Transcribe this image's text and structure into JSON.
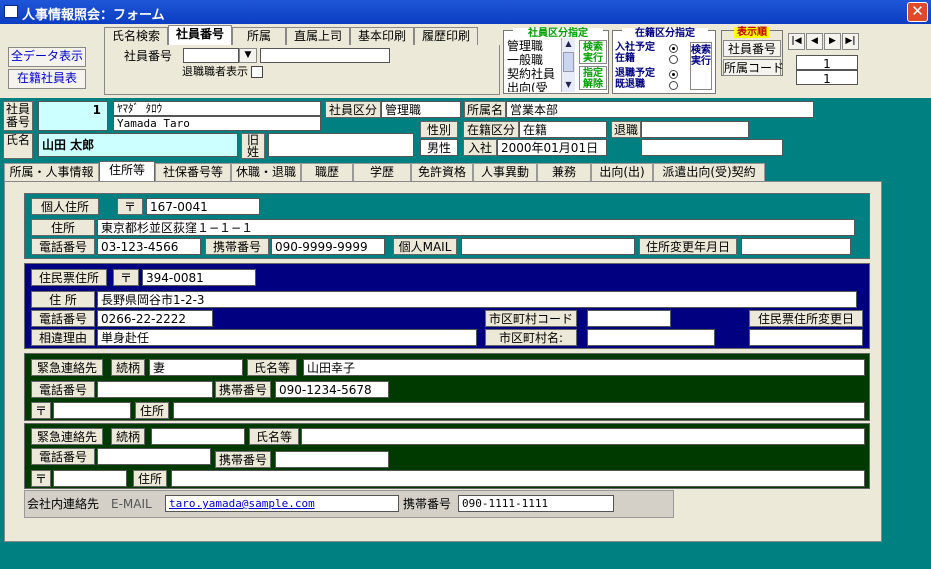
{
  "window": {
    "title": "人事情報照会：フォーム"
  },
  "header": {
    "search_tabs": [
      "氏名検索",
      "社員番号",
      "所属",
      "直属上司",
      "基本印刷",
      "履歴印刷"
    ],
    "all_data_button": "全データ表示",
    "active_employees_button": "在籍社員表",
    "employee_no_label": "社員番号",
    "retired_checkbox_label": "退職職者表示",
    "category_group": {
      "title": "社員区分指定",
      "items": [
        "管理職",
        "一般職",
        "契約社員",
        "出向(受"
      ],
      "search_button": "検索実行",
      "clear_button": "指定解除"
    },
    "status_group": {
      "title": "在籍区分指定",
      "options": [
        "入社予定",
        "在籍",
        "退職予定",
        "既退職"
      ],
      "selected": [
        0,
        2
      ],
      "search_button": "検索実行"
    },
    "display_order": {
      "title": "表示順",
      "employee_no_button": "社員番号",
      "dept_code_button": "所属コード"
    },
    "nav": {
      "first": "|◀",
      "prev": "◀",
      "next": "▶",
      "last": "▶|",
      "record": "1",
      "total": "1"
    }
  },
  "employee": {
    "emp_no_label": "社員番号",
    "emp_no": "1",
    "kana": "ﾔﾏﾀﾞ ﾀﾛｳ",
    "roman": "Yamada Taro",
    "category_label": "社員区分",
    "category": "管理職",
    "dept_label": "所属名",
    "dept": "営業本部",
    "name_label": "氏名",
    "name": "山田 太郎",
    "old_surname_label": "旧姓",
    "old_surname": "",
    "gender_label": "性別",
    "gender": "男性",
    "status_label": "在籍区分",
    "status": "在籍",
    "retire_label": "退職",
    "retire": "",
    "join_label": "入社",
    "join_date": "2000年01月01日"
  },
  "tabs": [
    "所属・人事情報",
    "住所等",
    "社保番号等",
    "休職・退職",
    "職歴",
    "学歴",
    "免許資格",
    "人事異動",
    "兼務",
    "出向(出)",
    "派遣出向(受)契約"
  ],
  "active_tab": 1,
  "personal": {
    "title": "個人住所",
    "postal_label": "〒",
    "postal": "167-0041",
    "address_label": "住所",
    "address": "東京都杉並区荻窪１−１−１",
    "phone_label": "電話番号",
    "phone": "03-123-4566",
    "mobile_label": "携帯番号",
    "mobile": "090-9999-9999",
    "mail_label": "個人MAIL",
    "mail": "",
    "changed_label": "住所変更年月日",
    "changed": ""
  },
  "resident": {
    "title": "住民票住所",
    "postal_label": "〒",
    "postal": "394-0081",
    "address_label": "住 所",
    "address": "長野県岡谷市1-2-3",
    "phone_label": "電話番号",
    "phone": "0266-22-2222",
    "city_code_label": "市区町村コード",
    "city_code": "",
    "reason_label": "相違理由",
    "reason": "単身赴任",
    "city_name_label": "市区町村名:",
    "city_name": "",
    "changed_label": "住民票住所変更日",
    "changed": ""
  },
  "emergency1": {
    "title": "緊急連絡先",
    "relation_label": "続柄",
    "relation": "妻",
    "name_label": "氏名等",
    "name": "山田幸子",
    "phone_label": "電話番号",
    "phone": "",
    "mobile_label": "携帯番号",
    "mobile": "090-1234-5678",
    "postal_label": "〒",
    "postal": "",
    "address_label": "住所",
    "address": ""
  },
  "emergency2": {
    "title": "緊急連絡先",
    "relation_label": "続柄",
    "relation": "",
    "name_label": "氏名等",
    "name": "",
    "phone_label": "電話番号",
    "phone": "",
    "mobile_label": "携帯番号",
    "mobile": "",
    "postal_label": "〒",
    "postal": "",
    "address_label": "住所",
    "address": ""
  },
  "company": {
    "title": "会社内連絡先",
    "email_label": "E-MAIL",
    "email": "taro.yamada@sample.com",
    "mobile_label": "携帯番号",
    "mobile": "090-1111-1111"
  },
  "colors": {
    "titlebar": "#0b3ec2",
    "teal": "#008080",
    "personal_bg": "#008080",
    "resident_bg": "#000080",
    "emergency_bg": "#003a00",
    "field_cyan": "#ccffff"
  }
}
